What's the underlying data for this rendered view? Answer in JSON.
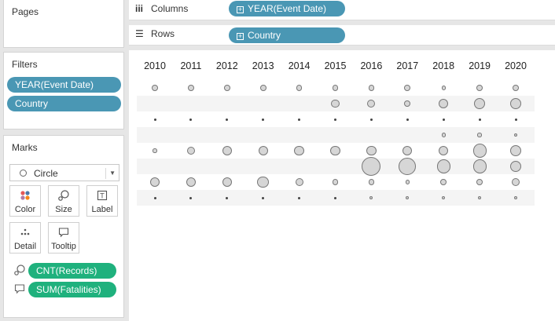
{
  "pages": {
    "title": "Pages"
  },
  "filters": {
    "title": "Filters",
    "items": [
      "YEAR(Event Date)",
      "Country"
    ]
  },
  "marks": {
    "title": "Marks",
    "mark_type": "Circle",
    "buttons": {
      "color": "Color",
      "size": "Size",
      "label": "Label",
      "detail": "Detail",
      "tooltip": "Tooltip"
    },
    "fields": [
      {
        "icon": "size-icon",
        "label": "CNT(Records)"
      },
      {
        "icon": "tooltip-icon",
        "label": "SUM(Fatalities)"
      }
    ]
  },
  "shelves": {
    "columns": {
      "label": "Columns",
      "pill": "YEAR(Event Date)"
    },
    "rows": {
      "label": "Rows",
      "pill": "Country"
    }
  },
  "colors": {
    "pill_blue": "#4a97b4",
    "pill_green": "#1fb17d",
    "mark_fill": "#d6d6d6",
    "mark_stroke": "#777777"
  },
  "chart_data": {
    "type": "scatter",
    "years": [
      "2010",
      "2011",
      "2012",
      "2013",
      "2014",
      "2015",
      "2016",
      "2017",
      "2018",
      "2019",
      "2020"
    ],
    "rows": [
      {
        "sizes": [
          3,
          3,
          3,
          3,
          3,
          3,
          3,
          3,
          2,
          3,
          3
        ]
      },
      {
        "sizes": [
          0,
          0,
          0,
          0,
          0,
          4,
          4,
          3,
          5,
          6,
          6
        ]
      },
      {
        "sizes": [
          1,
          1,
          1,
          1,
          1,
          1,
          1,
          1,
          1,
          1,
          1
        ]
      },
      {
        "sizes": [
          0,
          0,
          0,
          0,
          0,
          0,
          0,
          0,
          2,
          2,
          1.5
        ]
      },
      {
        "sizes": [
          2,
          4,
          5,
          5,
          5,
          5,
          5,
          5,
          5,
          7,
          6
        ]
      },
      {
        "sizes": [
          0,
          0,
          0,
          0,
          0,
          0,
          10,
          9,
          7,
          7,
          6
        ]
      },
      {
        "sizes": [
          5,
          5,
          5,
          6,
          4,
          3,
          3,
          2,
          3,
          3,
          4
        ]
      },
      {
        "sizes": [
          1,
          1,
          1,
          1,
          1,
          1,
          1.5,
          1.5,
          1.5,
          1.5,
          1.5
        ]
      }
    ]
  }
}
